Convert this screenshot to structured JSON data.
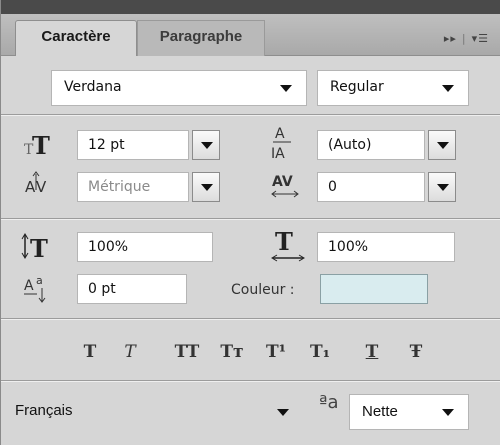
{
  "tabs": [
    {
      "label": "Caractère"
    },
    {
      "label": "Paragraphe"
    }
  ],
  "tab_tools": {
    "play": "▸▸",
    "separator": "|",
    "menu": "▾☰"
  },
  "font": {
    "family": "Verdana",
    "style": "Regular"
  },
  "size": {
    "value": "12 pt"
  },
  "leading": {
    "value": "(Auto)"
  },
  "kerning": {
    "value": "Métrique"
  },
  "tracking": {
    "value": "0"
  },
  "vertical_scale": {
    "value": "100%"
  },
  "horizontal_scale": {
    "value": "100%"
  },
  "baseline_shift": {
    "value": "0 pt"
  },
  "color": {
    "label": "Couleur :",
    "swatch": "#d9ecef"
  },
  "styles": {
    "faux_bold": "T",
    "faux_italic": "T",
    "all_caps": "TT",
    "small_caps": "Tт",
    "superscript": "T¹",
    "subscript": "T₁",
    "underline": "T",
    "strikethrough": "Ŧ"
  },
  "language": {
    "value": "Français"
  },
  "antialias": {
    "icon": "ªa",
    "value": "Nette"
  },
  "icons": [
    "size-icon",
    "leading-icon",
    "kerning-icon",
    "tracking-icon",
    "vertical-scale-icon",
    "horizontal-scale-icon",
    "baseline-shift-icon",
    "antialias-icon"
  ]
}
